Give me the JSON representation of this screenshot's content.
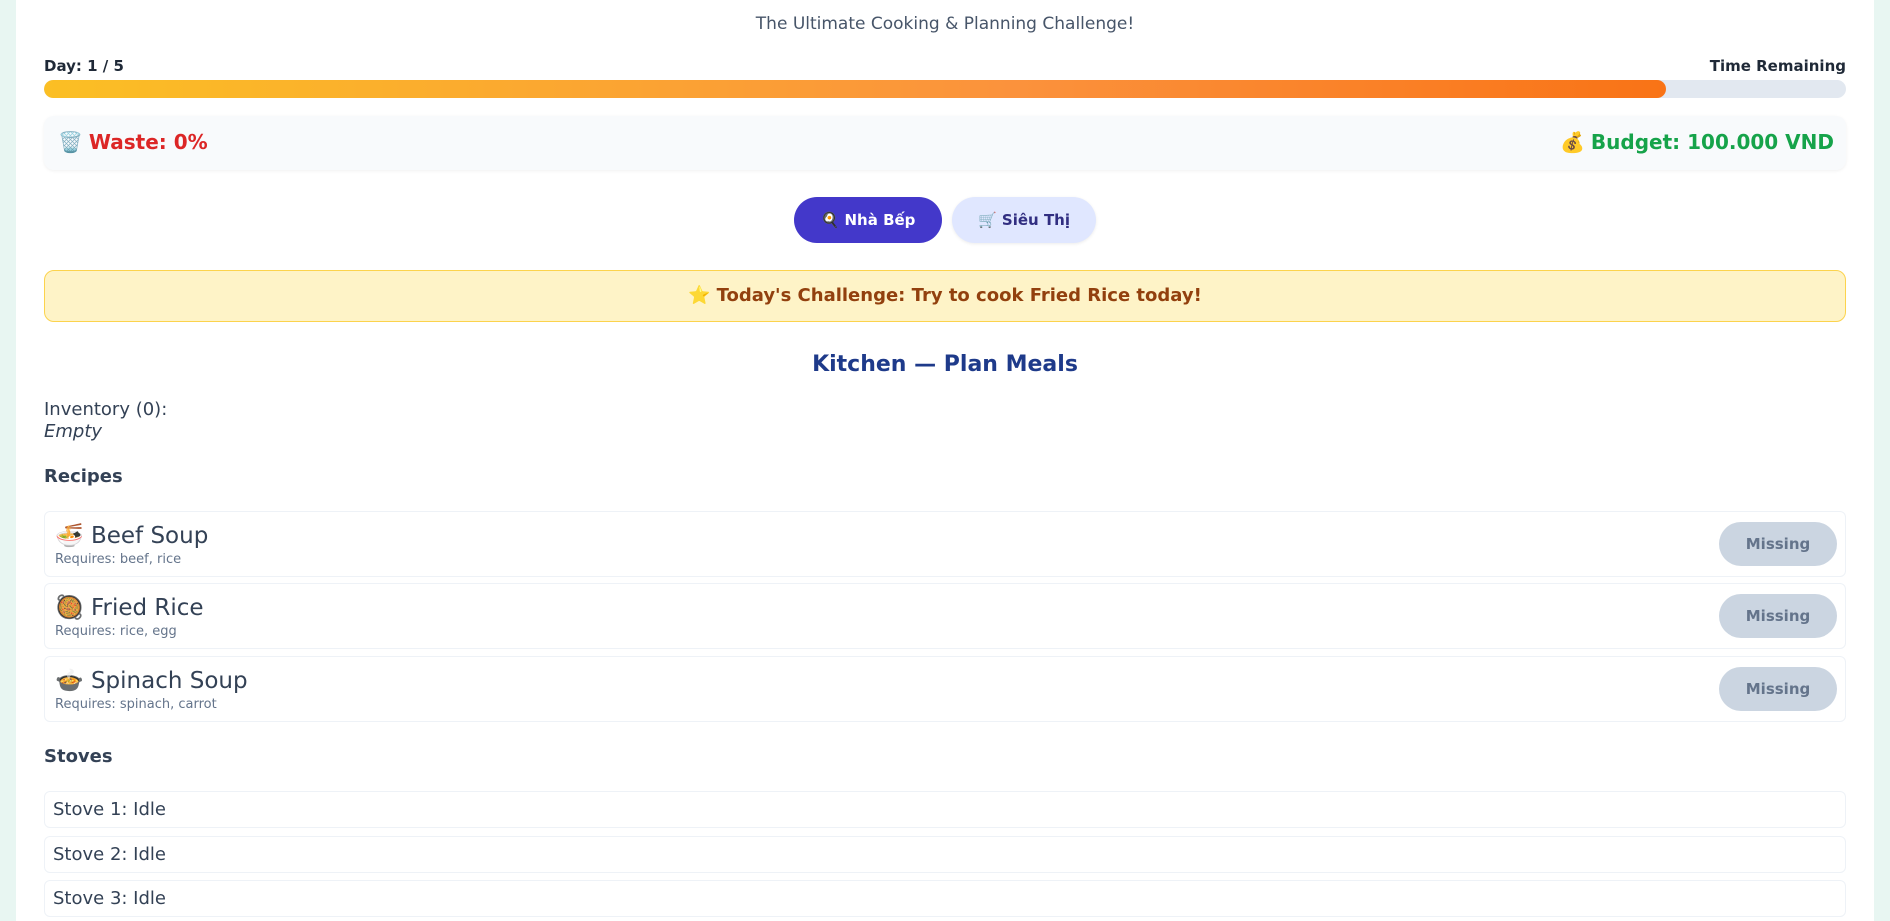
{
  "header": {
    "subtitle": "The Ultimate Cooking & Planning Challenge!"
  },
  "status": {
    "day_label": "Day: 1 / 5",
    "time_label": "Time Remaining",
    "time_progress": 0.9,
    "progress_colors": [
      "#fbbf24",
      "#f97316"
    ]
  },
  "stats": {
    "waste_icon": "🗑️",
    "waste_text": "Waste: 0%",
    "budget_icon": "💰",
    "budget_text": "Budget: 100.000 VND"
  },
  "tabs": [
    {
      "icon": "🍳",
      "label": "Nhà Bếp",
      "active": true
    },
    {
      "icon": "🛒",
      "label": "Siêu Thị",
      "active": false
    }
  ],
  "challenge": {
    "icon": "⭐",
    "text": "Today's Challenge: Try to cook Fried Rice today!"
  },
  "kitchen": {
    "title": "Kitchen — Plan Meals",
    "inventory_label": "Inventory (0):",
    "inventory_empty": "Empty",
    "recipes_heading": "Recipes",
    "recipes": [
      {
        "icon": "🍜",
        "name": "Beef Soup",
        "requires": "Requires: beef, rice",
        "button": "Missing"
      },
      {
        "icon": "🥘",
        "name": "Fried Rice",
        "requires": "Requires: rice, egg",
        "button": "Missing"
      },
      {
        "icon": "🍲",
        "name": "Spinach Soup",
        "requires": "Requires: spinach, carrot",
        "button": "Missing"
      }
    ],
    "stoves_heading": "Stoves",
    "stoves": [
      {
        "label": "Stove 1: Idle"
      },
      {
        "label": "Stove 2: Idle"
      },
      {
        "label": "Stove 3: Idle"
      }
    ]
  },
  "colors": {
    "accent": "#4338ca",
    "waste": "#dc2626",
    "budget": "#16a34a",
    "challenge_bg": "#fef3c7"
  }
}
